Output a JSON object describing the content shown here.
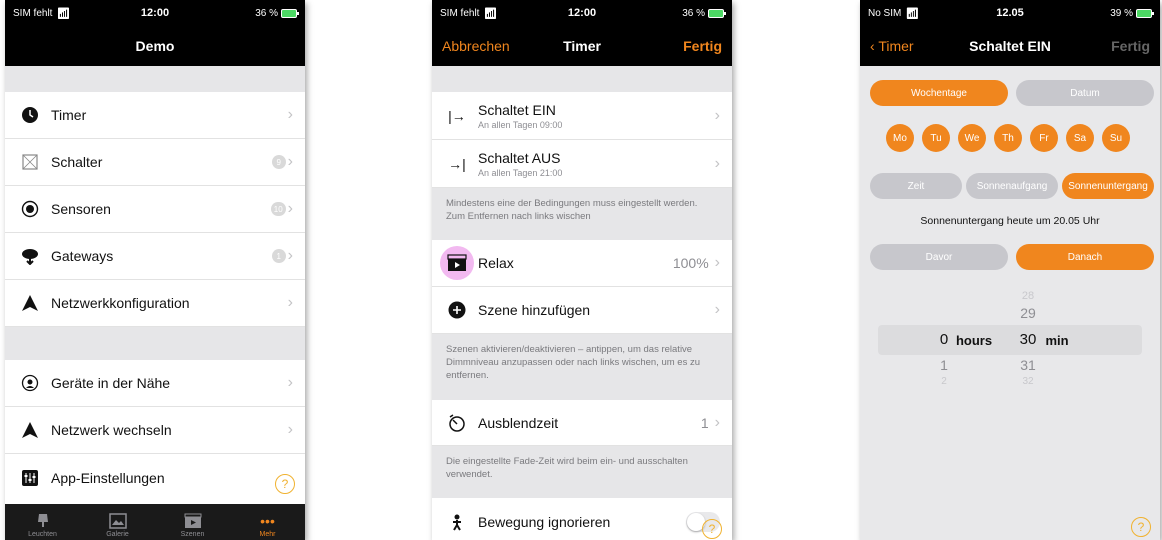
{
  "screen1": {
    "status": {
      "carrier": "SIM fehlt",
      "time": "12:00",
      "battery": "36 %"
    },
    "title": "Demo",
    "items": [
      {
        "icon": "clock-icon",
        "label": "Timer"
      },
      {
        "icon": "switch-icon",
        "label": "Schalter",
        "badge": "9"
      },
      {
        "icon": "sensor-icon",
        "label": "Sensoren",
        "badge": "10"
      },
      {
        "icon": "gateway-icon",
        "label": "Gateways",
        "badge": "1"
      },
      {
        "icon": "network-config-icon",
        "label": "Netzwerkkonfiguration"
      }
    ],
    "items2": [
      {
        "icon": "nearby-devices-icon",
        "label": "Geräte in der Nähe"
      },
      {
        "icon": "network-switch-icon",
        "label": "Netzwerk wechseln"
      },
      {
        "icon": "app-settings-icon",
        "label": "App-Einstellungen"
      }
    ],
    "tabs": [
      {
        "icon": "lamp-icon",
        "label": "Leuchten"
      },
      {
        "icon": "gallery-icon",
        "label": "Galerie"
      },
      {
        "icon": "scenes-icon",
        "label": "Szenen"
      },
      {
        "icon": "more-icon",
        "label": "Mehr",
        "glyph": "•••"
      }
    ],
    "accent": "#f0861e"
  },
  "screen2": {
    "status": {
      "carrier": "SIM fehlt",
      "time": "12:00",
      "battery": "36 %"
    },
    "nav": {
      "cancel": "Abbrechen",
      "title": "Timer",
      "done": "Fertig"
    },
    "conditions": [
      {
        "icon": "switch-on-icon",
        "glyph": "|→",
        "main": "Schaltet EIN",
        "sub": "An allen Tagen  09:00"
      },
      {
        "icon": "switch-off-icon",
        "glyph": "→|",
        "main": "Schaltet AUS",
        "sub": "An allen Tagen  21:00"
      }
    ],
    "note1": "Mindestens eine der Bedingungen muss eingestellt werden. Zum Entfernen nach links wischen",
    "scene": {
      "label": "Relax",
      "value": "100%"
    },
    "add_scene": "Szene hinzufügen",
    "note2": "Szenen aktivieren/deaktivieren – antippen, um das relative Dimmniveau anzupassen oder nach links wischen, um es zu entfernen.",
    "fade": {
      "label": "Ausblendzeit",
      "value": "1"
    },
    "note3": "Die eingestellte Fade-Zeit wird beim ein- und ausschalten verwendet.",
    "motion": {
      "label": "Bewegung ignorieren"
    }
  },
  "screen3": {
    "status": {
      "carrier": "No SIM",
      "time": "12.05",
      "battery": "39 %"
    },
    "nav": {
      "back": "Timer",
      "title": "Schaltet EIN",
      "done": "Fertig"
    },
    "mode_tabs": [
      "Wochentage",
      "Datum"
    ],
    "days": [
      "Mo",
      "Tu",
      "We",
      "Th",
      "Fr",
      "Sa",
      "Su"
    ],
    "trigger_tabs": [
      "Zeit",
      "Sonnenaufgang",
      "Sonnenuntergang"
    ],
    "info": "Sonnenuntergang heute um 20.05 Uhr",
    "offset_tabs": [
      "Davor",
      "Danach"
    ],
    "picker": {
      "hours_unit": "hours",
      "min_unit": "min",
      "hours": [
        "0",
        "1",
        "2"
      ],
      "minutes": [
        "28",
        "29",
        "30",
        "31",
        "32"
      ]
    }
  }
}
